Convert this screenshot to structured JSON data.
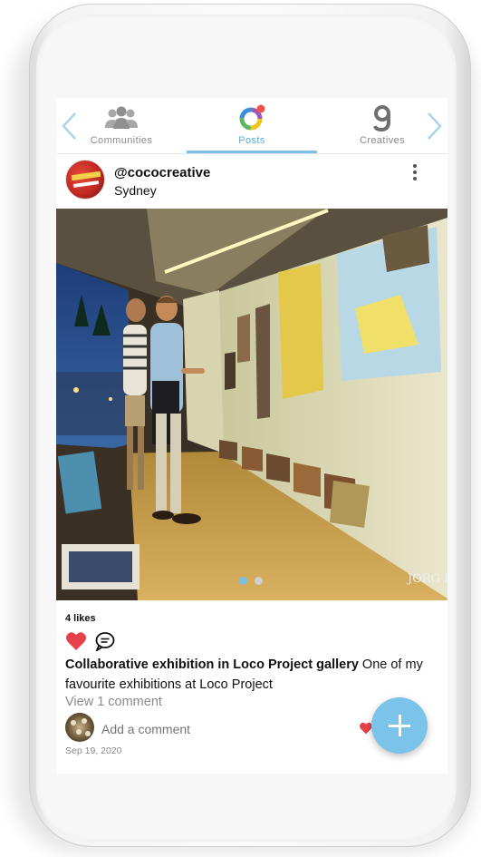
{
  "tabs": [
    {
      "label": "Communities",
      "icon": "people-icon",
      "active": false
    },
    {
      "label": "Posts",
      "icon": "colorful-ring-icon",
      "active": true
    },
    {
      "label": "Creatives",
      "icon": "creatives-g-icon",
      "active": false
    }
  ],
  "post": {
    "username": "@cococreative",
    "location": "Sydney",
    "image_watermark": "JORG PHOTO",
    "likes": "4 likes",
    "caption_title": "Collaborative exhibition in Loco Project gallery",
    "caption_text": " One of my favourite exhibitions at Loco Project",
    "view_comments": "View 1 comment",
    "add_comment_placeholder": "Add a comment",
    "date": "Sep 19, 2020",
    "carousel_total": 2,
    "carousel_active": 1
  },
  "colors": {
    "accent": "#7cc0e6",
    "like_red": "#e8404a",
    "text_primary": "#111111",
    "text_muted": "#8a8a8a"
  }
}
